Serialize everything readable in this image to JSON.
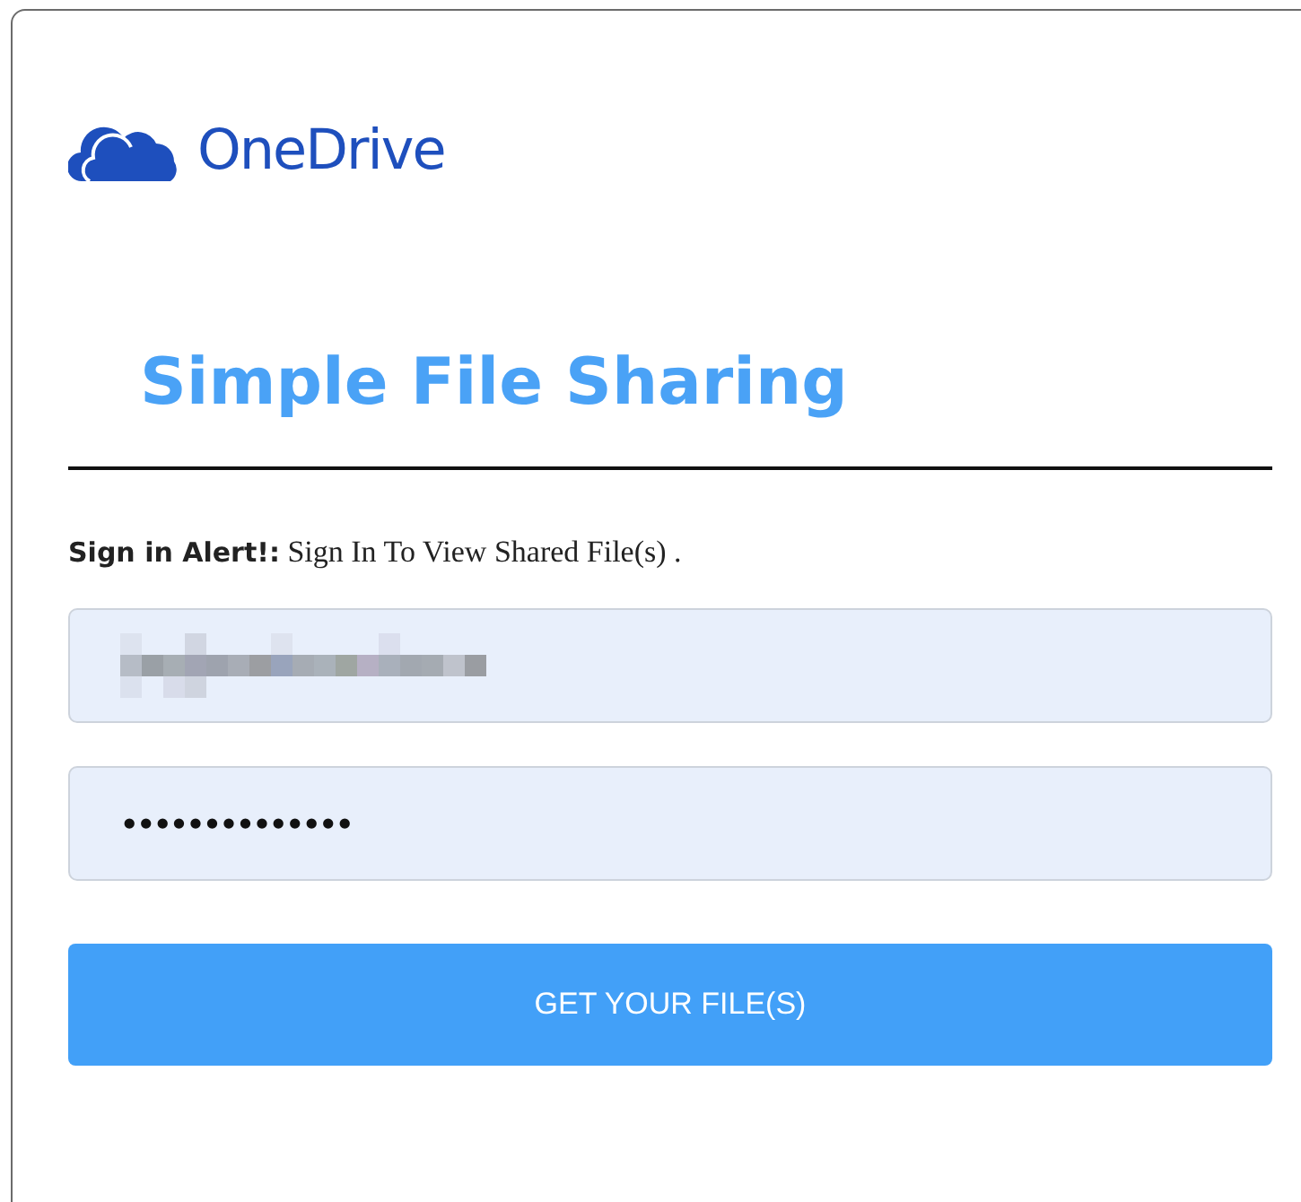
{
  "logo": {
    "text": "OneDrive"
  },
  "title": "Simple File Sharing",
  "alert": {
    "label": "Sign in Alert!:",
    "message": "Sign In To View Shared File(s) ."
  },
  "fields": [
    {
      "kind": "redacted"
    },
    {
      "kind": "password",
      "value": "••••••••••••••"
    }
  ],
  "button": "GET YOUR FILE(S)"
}
